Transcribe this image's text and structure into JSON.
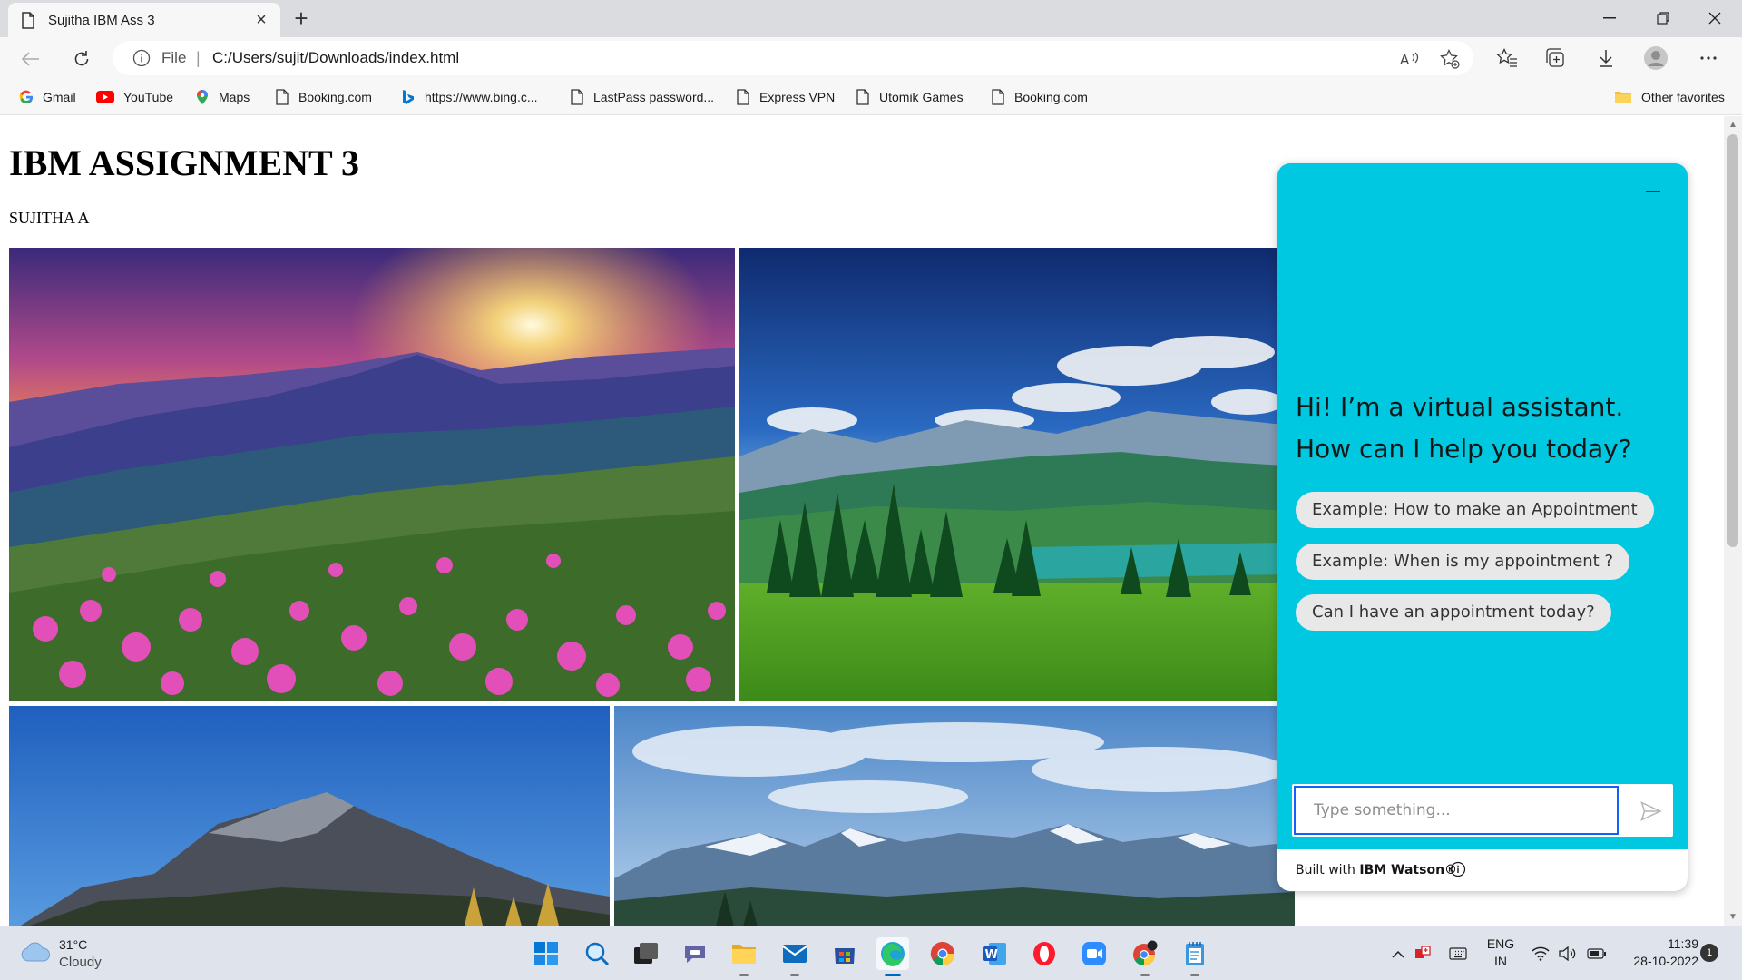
{
  "browser": {
    "tab_title": "Sujitha IBM Ass 3",
    "address": {
      "scheme_label": "File",
      "url": "C:/Users/sujit/Downloads/index.html"
    },
    "favorites": [
      {
        "label": "Gmail",
        "icon": "google-icon"
      },
      {
        "label": "YouTube",
        "icon": "youtube-icon"
      },
      {
        "label": "Maps",
        "icon": "maps-pin-icon"
      },
      {
        "label": "Booking.com",
        "icon": "page-icon"
      },
      {
        "label": "https://www.bing.c...",
        "icon": "bing-icon"
      },
      {
        "label": "LastPass password...",
        "icon": "page-icon"
      },
      {
        "label": "Express VPN",
        "icon": "page-icon"
      },
      {
        "label": "Utomik Games",
        "icon": "page-icon"
      },
      {
        "label": "Booking.com",
        "icon": "page-icon"
      }
    ],
    "other_favorites": "Other favorites"
  },
  "page": {
    "title": "IBM ASSIGNMENT 3",
    "author": "SUJITHA A"
  },
  "assistant": {
    "greeting": "Hi! I’m a virtual assistant. How can I help you today?",
    "suggestions": [
      "Example: How to make an Appointment",
      "Example: When is my appointment ?",
      "Can I have an appointment today?"
    ],
    "input_placeholder": "Type something...",
    "footer_prefix": "Built with ",
    "footer_brand": "IBM Watson®",
    "accent_color": "#00c8e0"
  },
  "taskbar": {
    "weather_temp": "31°C",
    "weather_desc": "Cloudy",
    "lang_line1": "ENG",
    "lang_line2": "IN",
    "time": "11:39",
    "date": "28-10-2022",
    "notification_count": "1"
  }
}
